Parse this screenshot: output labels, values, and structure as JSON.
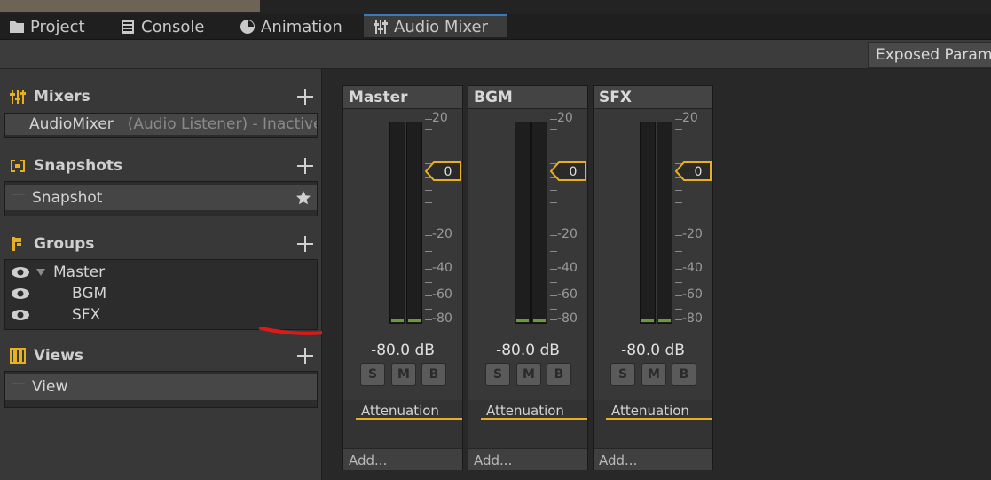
{
  "tabs": [
    {
      "label": "Project",
      "icon": "folder-icon"
    },
    {
      "label": "Console",
      "icon": "console-icon"
    },
    {
      "label": "Animation",
      "icon": "animation-icon"
    },
    {
      "label": "Audio Mixer",
      "icon": "mixer-icon",
      "active": true
    }
  ],
  "toolbar": {
    "exposed_params": "Exposed Parameters"
  },
  "sections": {
    "mixers": {
      "title": "Mixers",
      "items": [
        {
          "name": "AudioMixer",
          "detail": "(Audio Listener) - Inactive"
        }
      ]
    },
    "snapshots": {
      "title": "Snapshots",
      "items": [
        {
          "name": "Snapshot"
        }
      ]
    },
    "groups": {
      "title": "Groups",
      "items": [
        {
          "name": "Master"
        },
        {
          "name": "BGM"
        },
        {
          "name": "SFX"
        }
      ]
    },
    "views": {
      "title": "Views",
      "items": [
        {
          "name": "View"
        }
      ]
    }
  },
  "strips": [
    {
      "name": "Master",
      "db": "-80.0 dB",
      "effect": "Attenuation",
      "add": "Add...",
      "zero": "0"
    },
    {
      "name": "BGM",
      "db": "-80.0 dB",
      "effect": "Attenuation",
      "add": "Add...",
      "zero": "0"
    },
    {
      "name": "SFX",
      "db": "-80.0 dB",
      "effect": "Attenuation",
      "add": "Add...",
      "zero": "0"
    }
  ],
  "meter_labels": {
    "top": "20",
    "m20": "-20",
    "m40": "-40",
    "m60": "-60",
    "m80": "-80"
  },
  "buttons": {
    "solo": "S",
    "mute": "M",
    "bypass": "B"
  },
  "colors": {
    "accent": "#e8b020",
    "tab_active": "#3a79bb",
    "meter_level": "#6a9a3a",
    "annotation": "#e01818"
  }
}
